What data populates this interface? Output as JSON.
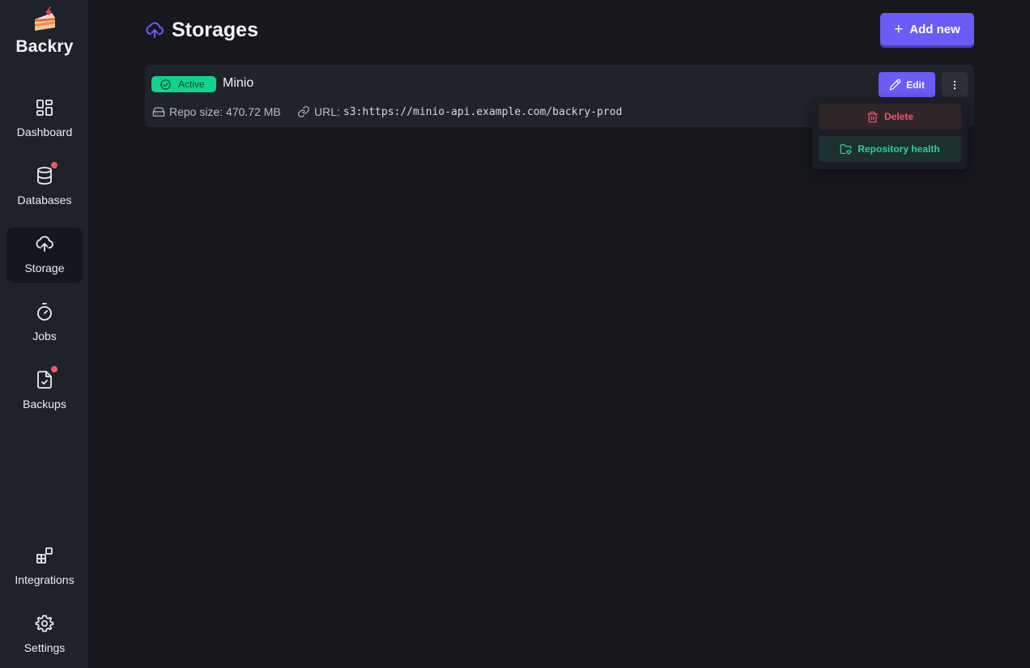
{
  "app": {
    "name": "Backry",
    "logo_icon": "cake-slice-icon"
  },
  "sidebar": {
    "items": [
      {
        "label": "Dashboard",
        "icon": "layout-grid-icon",
        "active": false,
        "notification": false
      },
      {
        "label": "Databases",
        "icon": "database-icon",
        "active": false,
        "notification": true
      },
      {
        "label": "Storage",
        "icon": "cloud-upload-icon",
        "active": true,
        "notification": false
      },
      {
        "label": "Jobs",
        "icon": "stopwatch-icon",
        "active": false,
        "notification": false
      },
      {
        "label": "Backups",
        "icon": "file-check-icon",
        "active": false,
        "notification": true
      }
    ],
    "bottom_items": [
      {
        "label": "Integrations",
        "icon": "blocks-icon"
      },
      {
        "label": "Settings",
        "icon": "gear-icon"
      }
    ]
  },
  "header": {
    "title": "Storages",
    "icon": "cloud-upload-icon",
    "add_button": "Add new"
  },
  "storages": [
    {
      "status": "Active",
      "name": "Minio",
      "repo_size_label": "Repo size: 470.72 MB",
      "url_label": "URL:",
      "url": "s3:https://minio-api.example.com/backry-prod",
      "edit_label": "Edit"
    }
  ],
  "dropdown": {
    "delete_label": "Delete",
    "health_label": "Repository health"
  },
  "colors": {
    "accent": "#6a5cf6",
    "active_badge": "#13d48a",
    "danger": "#f0566e",
    "success": "#2fd38c",
    "background": "#16181e",
    "sidebar": "#1e222a"
  }
}
